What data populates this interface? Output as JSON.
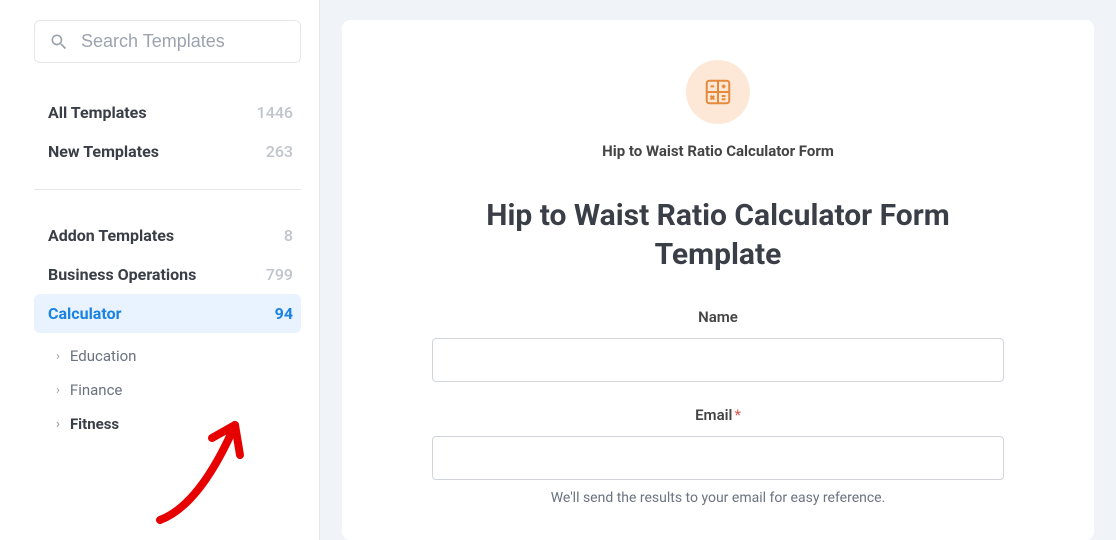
{
  "search": {
    "placeholder": "Search Templates"
  },
  "topCats": [
    {
      "label": "All Templates",
      "count": "1446"
    },
    {
      "label": "New Templates",
      "count": "263"
    }
  ],
  "cats": [
    {
      "label": "Addon Templates",
      "count": "8"
    },
    {
      "label": "Business Operations",
      "count": "799"
    },
    {
      "label": "Calculator",
      "count": "94"
    }
  ],
  "subCats": [
    {
      "label": "Education",
      "bold": false
    },
    {
      "label": "Finance",
      "bold": false
    },
    {
      "label": "Fitness",
      "bold": true
    }
  ],
  "preview": {
    "smallTitle": "Hip to Waist Ratio Calculator Form",
    "bigTitle": "Hip to Waist Ratio Calculator Form Template",
    "nameLabel": "Name",
    "emailLabel": "Email",
    "emailReq": "*",
    "helper": "We'll send the results to your email for easy reference."
  }
}
